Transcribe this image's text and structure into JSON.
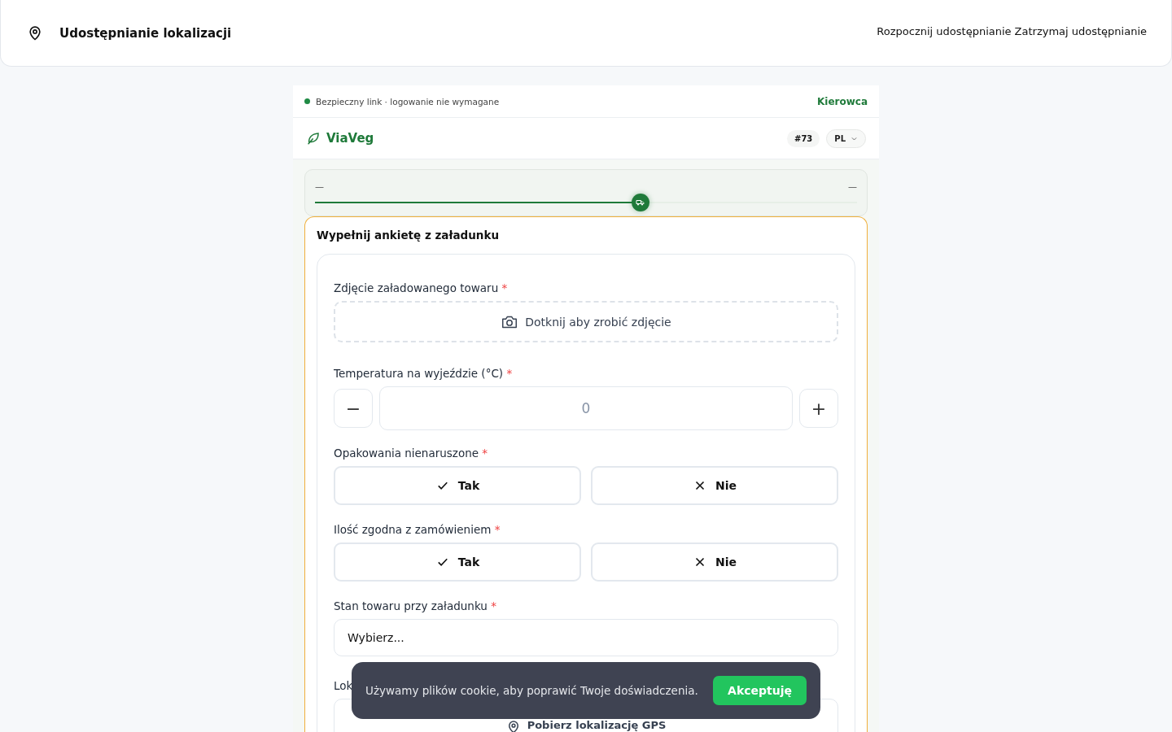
{
  "header": {
    "title": "Udostępnianie lokalizacji",
    "actions": [
      "Rozpocznij udostępnianie",
      "Zatrzymaj udostępnianie"
    ]
  },
  "notice": {
    "text": "Bezpieczny link · logowanie nie wymagane",
    "role": "Kierowca"
  },
  "brand": {
    "name": "ViaVeg",
    "order": "#73",
    "language": "PL"
  },
  "progress": {
    "start": "—",
    "end": "—",
    "level": 0.6
  },
  "survey": {
    "title": "Wypełnij ankietę z załadunku",
    "fields": [
      {
        "kind": "photo",
        "label": "Zdjęcie załadowanego towaru",
        "required_mark": "*",
        "button": "Dotknij aby zrobić zdjęcie"
      },
      {
        "kind": "stepper",
        "label": "Temperatura na wyjeździe (°C)",
        "required_mark": "*",
        "value": "0",
        "minus": "−",
        "plus": "+"
      },
      {
        "kind": "choice",
        "label": "Opakowania nienaruszone",
        "required_mark": "*",
        "options": [
          {
            "label": "Tak",
            "kind": "yes",
            "selected": false
          },
          {
            "label": "Nie",
            "kind": "no",
            "selected": false
          }
        ]
      },
      {
        "kind": "choice",
        "label": "Ilość zgodna z zamówieniem",
        "required_mark": "*",
        "options": [
          {
            "label": "Tak",
            "kind": "yes",
            "selected": false
          },
          {
            "label": "Nie",
            "kind": "no",
            "selected": false
          }
        ]
      },
      {
        "kind": "select",
        "label": "Stan towaru przy załadunku",
        "required_mark": "*",
        "value": "Wybierz..."
      },
      {
        "kind": "location",
        "label": "Lok",
        "button": "Pobierz lokalizację GPS"
      }
    ]
  },
  "cookie": {
    "text": "Używamy plików cookie, aby poprawić Twoje doświadczenia.",
    "button": "Akceptuję"
  }
}
